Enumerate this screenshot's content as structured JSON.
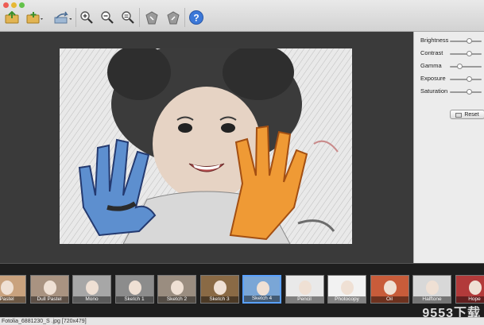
{
  "toolbar": {
    "icons": [
      "open-image-icon",
      "import-folder-icon",
      "share-icon",
      "zoom-in-icon",
      "zoom-out-icon",
      "zoom-fit-icon",
      "rotate-left-icon",
      "rotate-right-icon",
      "help-icon"
    ]
  },
  "adjustments": [
    {
      "label": "Brightness",
      "level": 0.6
    },
    {
      "label": "Contrast",
      "level": 0.6
    },
    {
      "label": "Gamma",
      "level": 0.3
    },
    {
      "label": "Exposure",
      "level": 0.6
    },
    {
      "label": "Saturation",
      "level": 0.6
    }
  ],
  "reset_label": "Reset",
  "filters": [
    {
      "label": "Pastel"
    },
    {
      "label": "Dull Pastel"
    },
    {
      "label": "Mono"
    },
    {
      "label": "Sketch 1"
    },
    {
      "label": "Sketch 2"
    },
    {
      "label": "Sketch 3"
    },
    {
      "label": "Sketch 4",
      "selected": true
    },
    {
      "label": "Pencil"
    },
    {
      "label": "Photocopy"
    },
    {
      "label": "Oil"
    },
    {
      "label": "Halftone"
    },
    {
      "label": "Hope"
    }
  ],
  "status_text": "Fotolia_6881230_S .jpg [720x479]",
  "watermark": "9553下载",
  "colors": {
    "selection": "#5aa0ff",
    "canvas": "#3a3a3a",
    "help": "#3c78d8"
  }
}
